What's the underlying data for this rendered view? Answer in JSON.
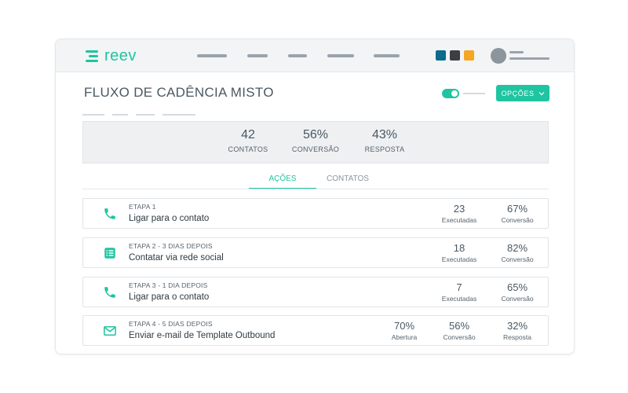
{
  "brand": {
    "logo_text": "reev",
    "accent": "#1fc4a0"
  },
  "header": {
    "swatches": [
      "#0d6b8c",
      "#3b3f43",
      "#f5a623"
    ]
  },
  "page": {
    "title": "FLUXO DE CADÊNCIA MISTO",
    "options_label": "OPÇÕES",
    "toggle_on": true
  },
  "stats": [
    {
      "value": "42",
      "label": "CONTATOS"
    },
    {
      "value": "56%",
      "label": "CONVERSÃO"
    },
    {
      "value": "43%",
      "label": "RESPOSTA"
    }
  ],
  "tabs": [
    {
      "label": "AÇÕES",
      "active": true
    },
    {
      "label": "CONTATOS",
      "active": false
    }
  ],
  "steps": [
    {
      "icon": "phone-icon",
      "step": "ETAPA 1",
      "title": "Ligar para o contato",
      "metrics": [
        {
          "value": "23",
          "label": "Executadas"
        },
        {
          "value": "67%",
          "label": "Conversão"
        }
      ]
    },
    {
      "icon": "social-list-icon",
      "step": "ETAPA 2 - 3 DIAS DEPOIS",
      "title": "Contatar via rede social",
      "metrics": [
        {
          "value": "18",
          "label": "Executadas"
        },
        {
          "value": "82%",
          "label": "Conversão"
        }
      ]
    },
    {
      "icon": "phone-icon",
      "step": "ETAPA 3 - 1 DIA DEPOIS",
      "title": "Ligar para o contato",
      "metrics": [
        {
          "value": "7",
          "label": "Executadas"
        },
        {
          "value": "65%",
          "label": "Conversão"
        }
      ]
    },
    {
      "icon": "email-icon",
      "step": "ETAPA 4 - 5 DIAS DEPOIS",
      "title": "Enviar e-mail de Template Outbound",
      "metrics": [
        {
          "value": "70%",
          "label": "Abertura"
        },
        {
          "value": "56%",
          "label": "Conversão"
        },
        {
          "value": "32%",
          "label": "Resposta"
        }
      ]
    }
  ]
}
